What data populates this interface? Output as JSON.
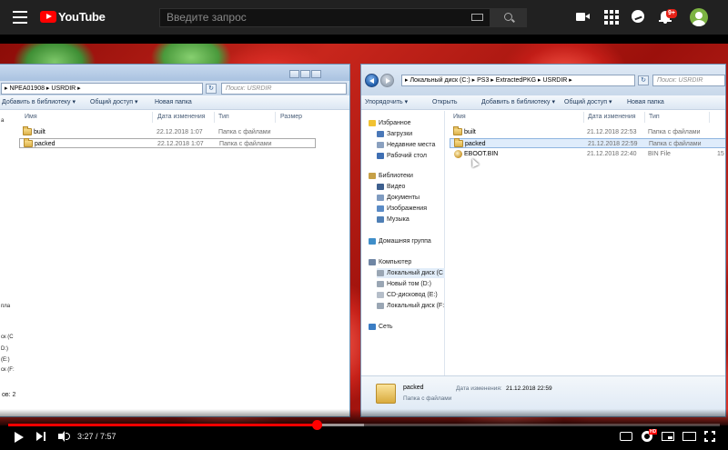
{
  "youtube": {
    "logo_text": "YouTube",
    "search_placeholder": "Введите запрос",
    "notifications_badge": "9+"
  },
  "left_window": {
    "path": "▸ NPEA01908 ▸ USRDIR ▸",
    "search_placeholder": "Поиск: USRDIR",
    "toolbar": [
      "Добавить в библиотеку ▾",
      "Общий доступ ▾",
      "Новая папка"
    ],
    "columns": [
      "Имя",
      "Дата изменения",
      "Тип",
      "Размер"
    ],
    "rows": [
      {
        "name": "built",
        "date": "22.12.2018 1:07",
        "type": "Папка с файлами"
      },
      {
        "name": "packed",
        "date": "22.12.2018 1:07",
        "type": "Папка с файлами"
      }
    ],
    "nav_fragments": [
      "a",
      "пла",
      "ск (C",
      "D:)",
      "(E:)",
      "ск (F:"
    ],
    "status": "ов: 2"
  },
  "right_window": {
    "path": "▸ Локальный диск (C:) ▸ PS3 ▸ ExtractedPKG ▸ USRDIR ▸",
    "search_placeholder": "Поиск: USRDIR",
    "toolbar": [
      "Упорядочить ▾",
      "Открыть",
      "Добавить в библиотеку ▾",
      "Общий доступ ▾",
      "Новая папка"
    ],
    "columns": [
      "Имя",
      "Дата изменения",
      "Тип"
    ],
    "rows": [
      {
        "name": "built",
        "date": "21.12.2018 22:53",
        "type": "Папка с файлами",
        "size": ""
      },
      {
        "name": "packed",
        "date": "21.12.2018 22:59",
        "type": "Папка с файлами",
        "size": ""
      },
      {
        "name": "EBOOT.BIN",
        "date": "21.12.2018 22:40",
        "type": "BIN File",
        "size": "15"
      }
    ],
    "nav": {
      "favorites": "Избранное",
      "downloads": "Загрузки",
      "recent": "Недавние места",
      "desktop": "Рабочий стол",
      "libraries": "Библиотеки",
      "video": "Видео",
      "documents": "Документы",
      "images": "Изображения",
      "music": "Музыка",
      "homegroup": "Домашняя группа",
      "computer": "Компьютер",
      "disk_c": "Локальный диск (C",
      "disk_d": "Новый том (D:)",
      "disk_e": "CD-дисковод (E:)",
      "disk_f": "Локальный диск (F:",
      "network": "Сеть"
    },
    "details": {
      "name": "packed",
      "type": "Папка с файлами",
      "date_label": "Дата изменения:",
      "date": "21.12.2018 22:59"
    }
  },
  "player": {
    "time": "3:27 / 7:57",
    "progress": 0.434,
    "buffered": 0.5,
    "hd_badge": "HD"
  },
  "colors": {
    "accent": "#ff0000",
    "topbar": "#212121",
    "selection": "#dfecfb"
  }
}
